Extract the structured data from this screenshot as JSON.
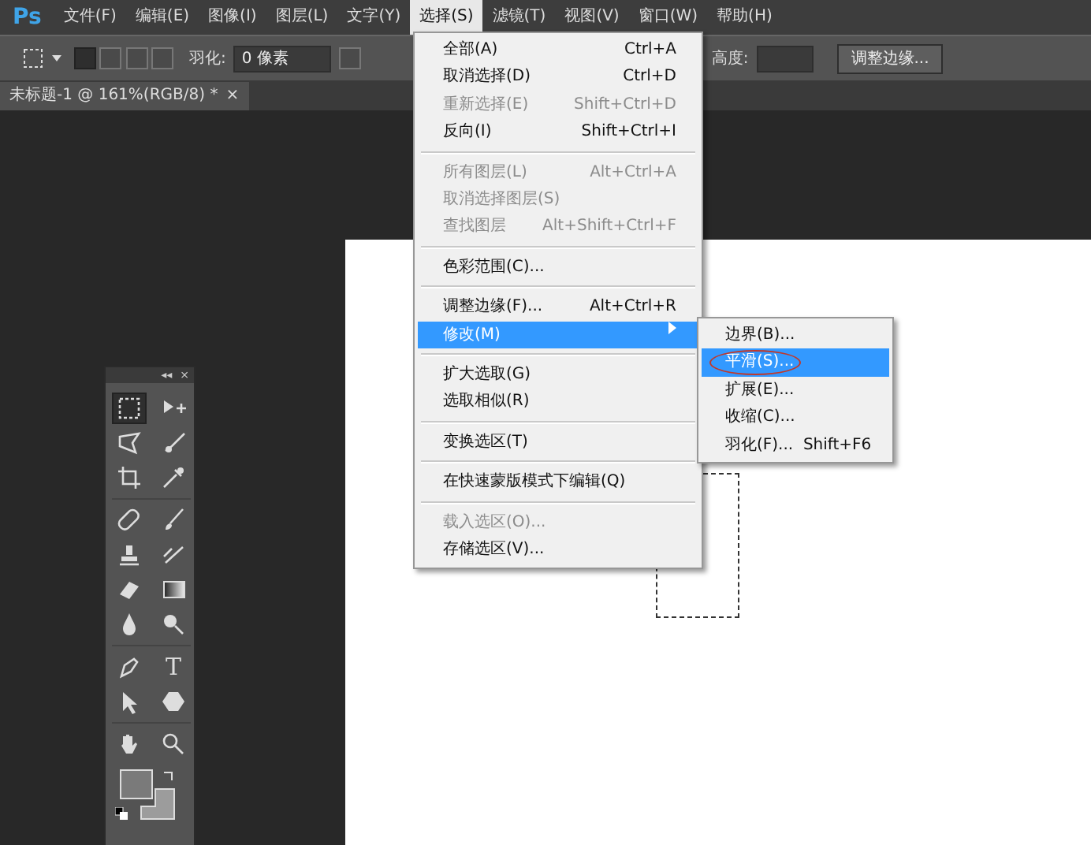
{
  "menu_bar": {
    "logo": "Ps",
    "items": [
      {
        "label": "文件(F)",
        "selected": false
      },
      {
        "label": "编辑(E)",
        "selected": false
      },
      {
        "label": "图像(I)",
        "selected": false
      },
      {
        "label": "图层(L)",
        "selected": false
      },
      {
        "label": "文字(Y)",
        "selected": false
      },
      {
        "label": "选择(S)",
        "selected": true
      },
      {
        "label": "滤镜(T)",
        "selected": false
      },
      {
        "label": "视图(V)",
        "selected": false
      },
      {
        "label": "窗口(W)",
        "selected": false
      },
      {
        "label": "帮助(H)",
        "selected": false
      }
    ]
  },
  "options_bar": {
    "modes": [
      {
        "selected": true
      },
      {
        "selected": false
      },
      {
        "selected": false
      },
      {
        "selected": false
      }
    ],
    "anti_alias_checked": false,
    "feather_label": "羽化:",
    "feather_value": "0 像素",
    "height_label": "高度:",
    "refine_button": "调整边缘..."
  },
  "document_tab": {
    "title": "未标题-1 @ 161%(RGB/8) *",
    "close": "×"
  },
  "select_menu": [
    {
      "kind": "item",
      "label": "全部(A)",
      "shortcut": "Ctrl+A",
      "disabled": false,
      "selected": false,
      "submenu": false
    },
    {
      "kind": "item",
      "label": "取消选择(D)",
      "shortcut": "Ctrl+D",
      "disabled": false,
      "selected": false,
      "submenu": false
    },
    {
      "kind": "item",
      "label": "重新选择(E)",
      "shortcut": "Shift+Ctrl+D",
      "disabled": true,
      "selected": false,
      "submenu": false
    },
    {
      "kind": "item",
      "label": "反向(I)",
      "shortcut": "Shift+Ctrl+I",
      "disabled": false,
      "selected": false,
      "submenu": false
    },
    {
      "kind": "separator"
    },
    {
      "kind": "item",
      "label": "所有图层(L)",
      "shortcut": "Alt+Ctrl+A",
      "disabled": true,
      "selected": false,
      "submenu": false
    },
    {
      "kind": "item",
      "label": "取消选择图层(S)",
      "disabled": true,
      "selected": false,
      "submenu": false
    },
    {
      "kind": "item",
      "label": "查找图层",
      "shortcut": "Alt+Shift+Ctrl+F",
      "disabled": true,
      "selected": false,
      "submenu": false
    },
    {
      "kind": "separator"
    },
    {
      "kind": "item",
      "label": "色彩范围(C)...",
      "disabled": false,
      "selected": false,
      "submenu": false
    },
    {
      "kind": "separator"
    },
    {
      "kind": "item",
      "label": "调整边缘(F)...",
      "shortcut": "Alt+Ctrl+R",
      "disabled": false,
      "selected": false,
      "submenu": false
    },
    {
      "kind": "item",
      "label": "修改(M)",
      "disabled": false,
      "selected": true,
      "submenu": true
    },
    {
      "kind": "separator"
    },
    {
      "kind": "item",
      "label": "扩大选取(G)",
      "disabled": false,
      "selected": false,
      "submenu": false
    },
    {
      "kind": "item",
      "label": "选取相似(R)",
      "disabled": false,
      "selected": false,
      "submenu": false
    },
    {
      "kind": "separator"
    },
    {
      "kind": "item",
      "label": "变换选区(T)",
      "disabled": false,
      "selected": false,
      "submenu": false
    },
    {
      "kind": "separator"
    },
    {
      "kind": "item",
      "label": "在快速蒙版模式下编辑(Q)",
      "disabled": false,
      "selected": false,
      "submenu": false
    },
    {
      "kind": "separator"
    },
    {
      "kind": "item",
      "label": "载入选区(O)...",
      "disabled": true,
      "selected": false,
      "submenu": false
    },
    {
      "kind": "item",
      "label": "存储选区(V)...",
      "disabled": false,
      "selected": false,
      "submenu": false
    }
  ],
  "modify_submenu": [
    {
      "label": "边界(B)...",
      "selected": false,
      "circled": false
    },
    {
      "label": "平滑(S)...",
      "selected": true,
      "circled": true
    },
    {
      "label": "扩展(E)...",
      "selected": false,
      "circled": false
    },
    {
      "label": "收缩(C)...",
      "selected": false,
      "circled": false
    },
    {
      "label": "羽化(F)...",
      "shortcut": "Shift+F6",
      "selected": false,
      "circled": false
    }
  ],
  "toolbox": {
    "collapse": "◂◂",
    "close": "×",
    "type_glyph": "T",
    "tools": [
      {
        "selected": true
      },
      {
        "selected": false
      },
      {
        "selected": false
      },
      {
        "selected": false
      },
      {
        "selected": false
      },
      {
        "selected": false
      },
      {
        "selected": false
      },
      {
        "selected": false
      },
      {
        "selected": false
      },
      {
        "selected": false
      },
      {
        "selected": false
      },
      {
        "selected": false
      },
      {
        "selected": false
      },
      {
        "selected": false
      },
      {
        "selected": false
      },
      {
        "selected": false
      },
      {
        "selected": false
      },
      {
        "selected": false
      },
      {
        "selected": false
      },
      {
        "selected": false
      }
    ],
    "swatches": true
  }
}
